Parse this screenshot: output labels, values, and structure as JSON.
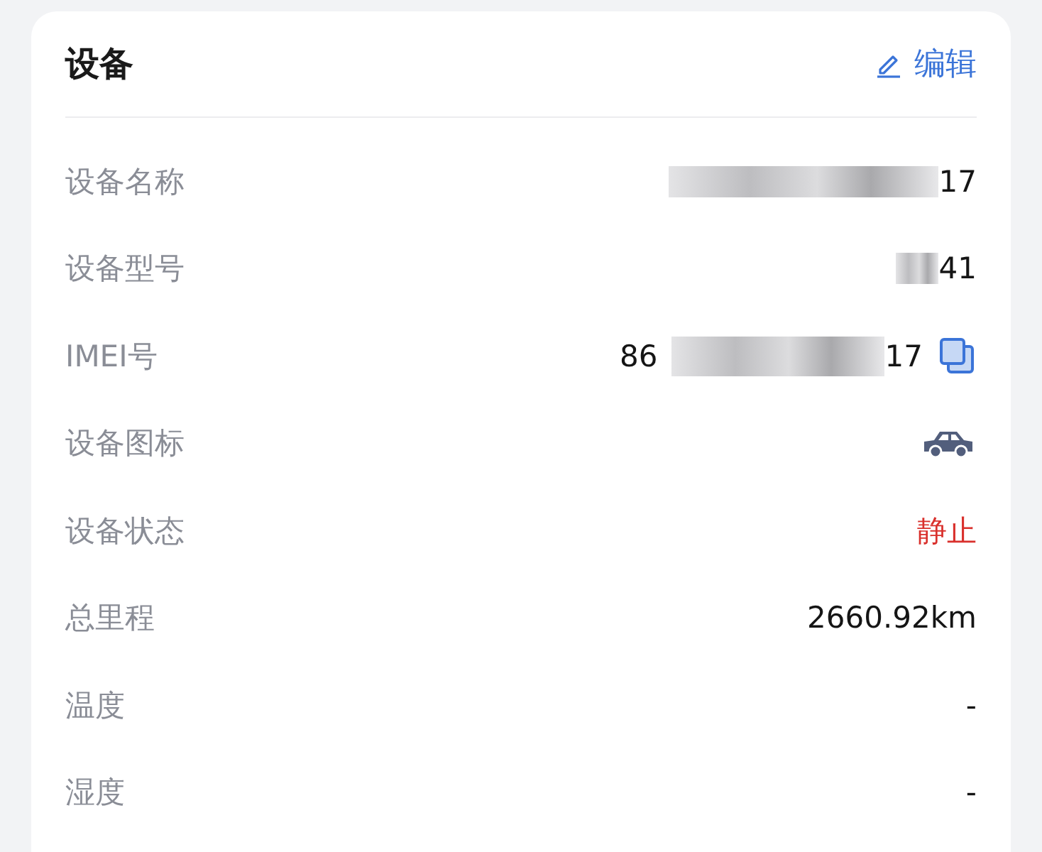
{
  "card": {
    "title": "设备",
    "edit_label": "编辑"
  },
  "rows": [
    {
      "kind": "text",
      "label": "设备名称",
      "value": "17",
      "redacted": true
    },
    {
      "kind": "text",
      "label": "设备型号",
      "value": "41",
      "redacted": true
    },
    {
      "kind": "copy",
      "label": "IMEI号",
      "prefix": "86",
      "value": "17",
      "redacted": true
    },
    {
      "kind": "icon",
      "label": "设备图标"
    },
    {
      "kind": "status",
      "label": "设备状态",
      "value": "静止",
      "color": "#d9302c"
    },
    {
      "kind": "text",
      "label": "总里程",
      "value": "2660.92km",
      "redacted": false
    },
    {
      "kind": "text",
      "label": "温度",
      "value": "-",
      "redacted": false
    },
    {
      "kind": "text",
      "label": "湿度",
      "value": "-",
      "redacted": false
    }
  ]
}
